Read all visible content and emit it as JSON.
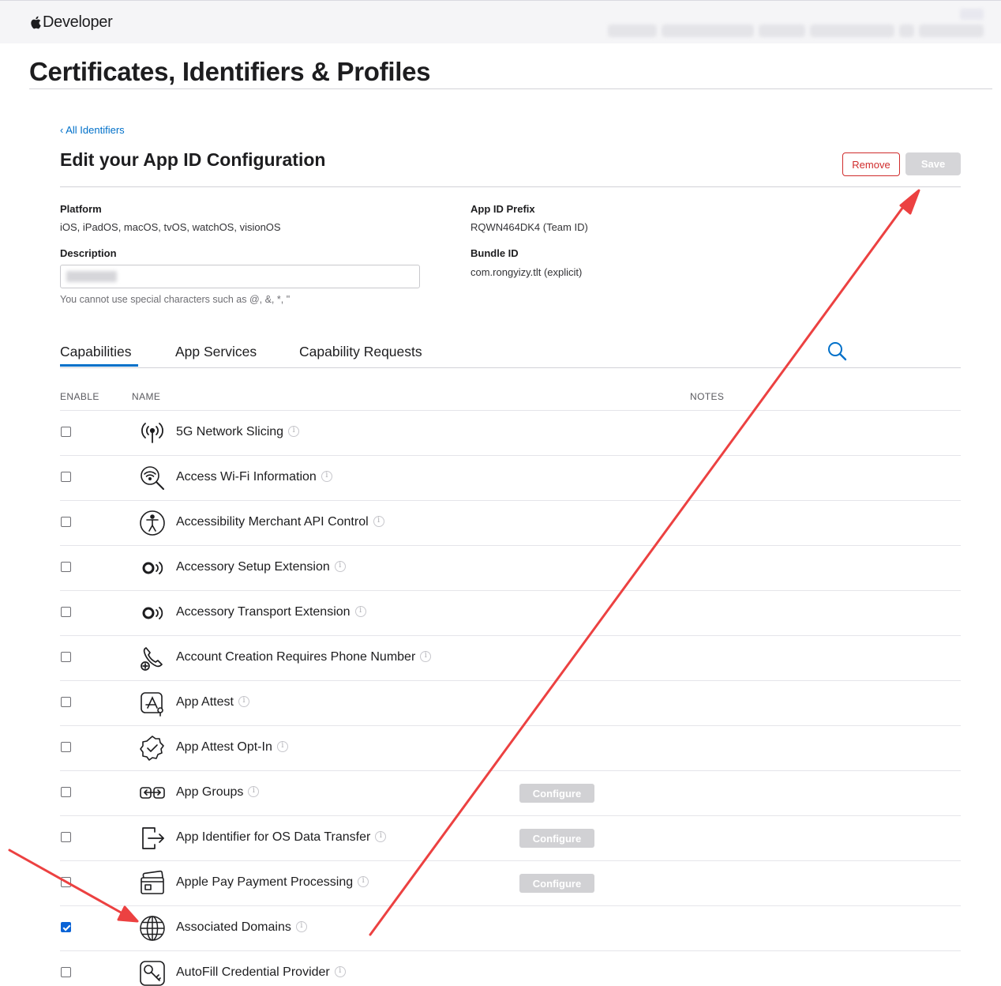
{
  "header": {
    "brand": "Developer"
  },
  "page": {
    "title": "Certificates, Identifiers & Profiles"
  },
  "nav": {
    "back_link": "‹ All Identifiers"
  },
  "section": {
    "title": "Edit your App ID Configuration"
  },
  "actions": {
    "remove_label": "Remove",
    "save_label": "Save"
  },
  "details": {
    "platform_label": "Platform",
    "platform_value": "iOS, iPadOS, macOS, tvOS, watchOS, visionOS",
    "app_id_prefix_label": "App ID Prefix",
    "app_id_prefix_value": "RQWN464DK4 (Team ID)",
    "description_label": "Description",
    "description_hint": "You cannot use special characters such as @, &, *, \"",
    "bundle_id_label": "Bundle ID",
    "bundle_id_value": "com.rongyizy.tlt (explicit)"
  },
  "tabs": [
    {
      "label": "Capabilities",
      "active": true
    },
    {
      "label": "App Services",
      "active": false
    },
    {
      "label": "Capability Requests",
      "active": false
    }
  ],
  "columns": {
    "enable": "ENABLE",
    "name": "NAME",
    "notes": "NOTES"
  },
  "configure_label": "Configure",
  "capabilities": [
    {
      "name": "5G Network Slicing",
      "enabled": false,
      "icon": "antenna-icon",
      "configure": false
    },
    {
      "name": "Access Wi-Fi Information",
      "enabled": false,
      "icon": "wifi-search-icon",
      "configure": false
    },
    {
      "name": "Accessibility Merchant API Control",
      "enabled": false,
      "icon": "accessibility-icon",
      "configure": false
    },
    {
      "name": "Accessory Setup Extension",
      "enabled": false,
      "icon": "accessory-icon",
      "configure": false
    },
    {
      "name": "Accessory Transport Extension",
      "enabled": false,
      "icon": "accessory-icon",
      "configure": false
    },
    {
      "name": "Account Creation Requires Phone Number",
      "enabled": false,
      "icon": "phone-plus-icon",
      "configure": false
    },
    {
      "name": "App Attest",
      "enabled": false,
      "icon": "app-attest-icon",
      "configure": false
    },
    {
      "name": "App Attest Opt-In",
      "enabled": false,
      "icon": "badge-check-icon",
      "configure": false
    },
    {
      "name": "App Groups",
      "enabled": false,
      "icon": "app-groups-icon",
      "configure": true
    },
    {
      "name": "App Identifier for OS Data Transfer",
      "enabled": false,
      "icon": "export-icon",
      "configure": true
    },
    {
      "name": "Apple Pay Payment Processing",
      "enabled": false,
      "icon": "wallet-card-icon",
      "configure": true
    },
    {
      "name": "Associated Domains",
      "enabled": true,
      "icon": "globe-icon",
      "configure": false
    },
    {
      "name": "AutoFill Credential Provider",
      "enabled": false,
      "icon": "key-icon",
      "configure": false
    }
  ],
  "colors": {
    "accent": "#0070c9",
    "remove": "#d02c2c",
    "annotation_arrow": "#ec4141"
  }
}
